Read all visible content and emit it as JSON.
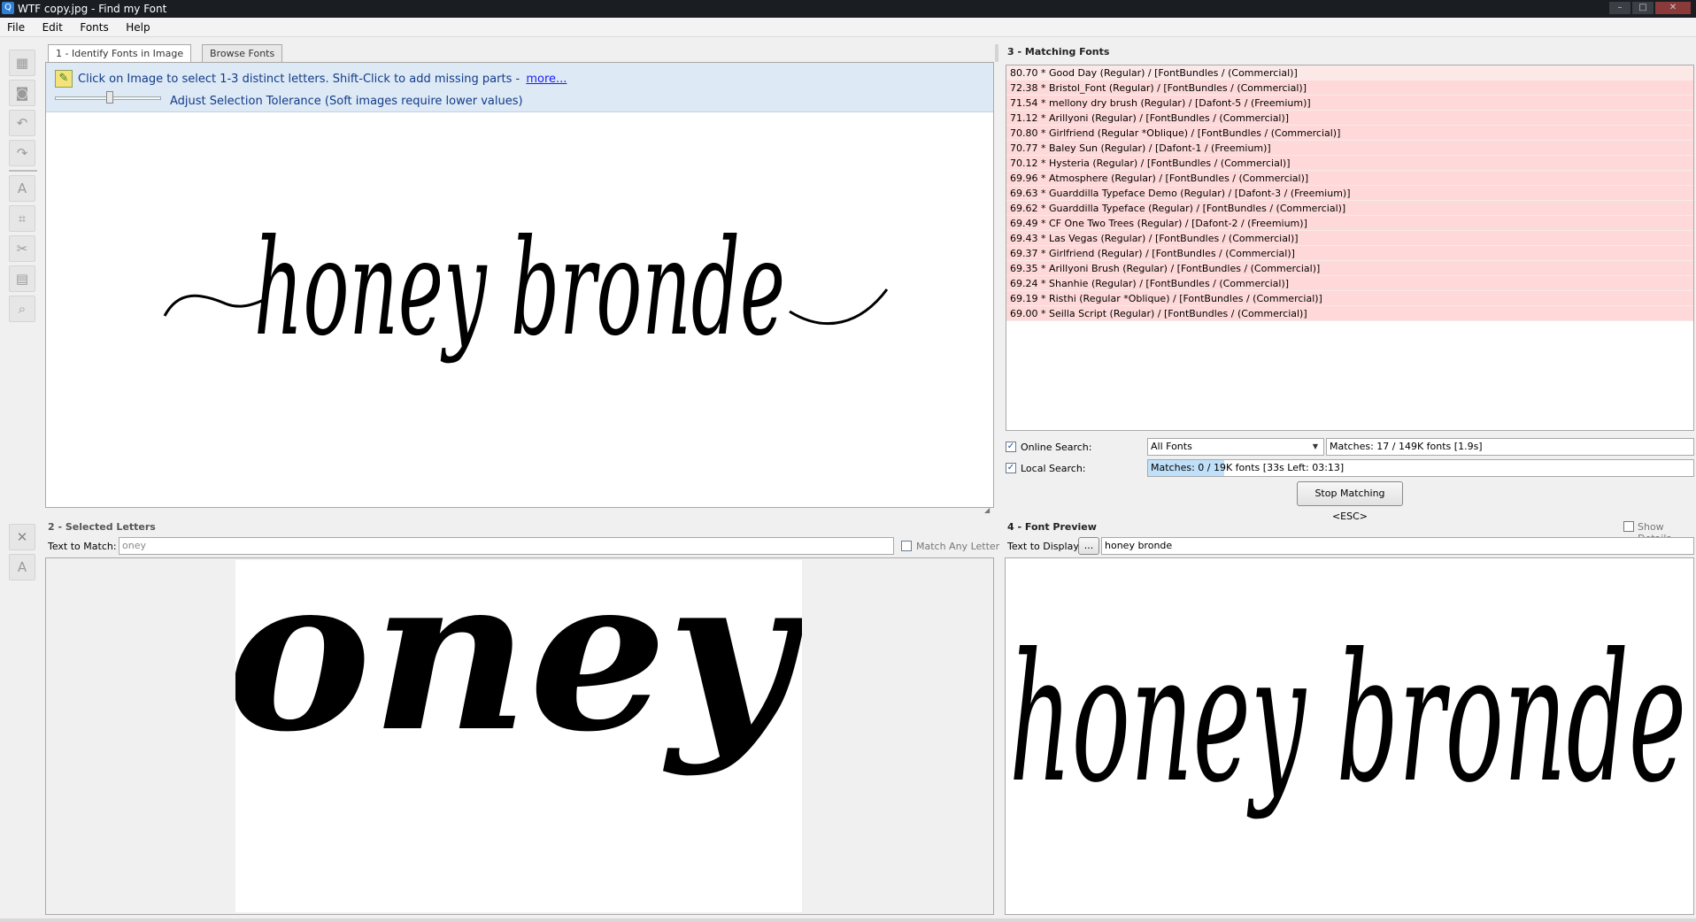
{
  "window": {
    "title": "WTF copy.jpg - Find my Font",
    "app_icon": "magnifier-icon",
    "controls": [
      "minimize",
      "maximize",
      "close"
    ]
  },
  "menu": [
    "File",
    "Edit",
    "Fonts",
    "Help"
  ],
  "toolbar_icons": [
    "identify-icon",
    "camera-icon",
    "undo-icon",
    "redo-icon",
    "add-letter-icon",
    "crop-icon",
    "cut-icon",
    "image-icon",
    "zoom-icon"
  ],
  "panel1": {
    "tabs": [
      "1 - Identify Fonts in Image",
      "Browse Fonts"
    ],
    "instruction": "Click on Image to select 1-3 distinct letters. Shift-Click to add missing parts -",
    "more_link": "more...",
    "tolerance_label": "Adjust Selection Tolerance (Soft images require lower values)",
    "tolerance_value": 0.5,
    "image_text": "honey bronde"
  },
  "panel2": {
    "title": "2 - Selected Letters",
    "text_to_match_label": "Text to Match:",
    "text_to_match_value": "oney",
    "match_any_letter_label": "Match Any Letter",
    "match_any_letter_checked": false,
    "letters_image_text": "oney"
  },
  "panel3": {
    "title": "3 - Matching Fonts",
    "matches": [
      "80.70 * Good Day (Regular) / [FontBundles / (Commercial)]",
      "72.38 * Bristol_Font (Regular) / [FontBundles / (Commercial)]",
      "71.54 * mellony dry brush (Regular) / [Dafont-5 / (Freemium)]",
      "71.12 * Arillyoni (Regular) / [FontBundles / (Commercial)]",
      "70.80 * Girlfriend (Regular *Oblique) / [FontBundles / (Commercial)]",
      "70.77 * Baley Sun (Regular) / [Dafont-1 / (Freemium)]",
      "70.12 * Hysteria (Regular) / [FontBundles / (Commercial)]",
      "69.96 * Atmosphere (Regular) / [FontBundles / (Commercial)]",
      "69.63 * Guarddilla Typeface Demo (Regular) / [Dafont-3 / (Freemium)]",
      "69.62 * Guarddilla Typeface (Regular) / [FontBundles / (Commercial)]",
      "69.49 * CF One Two Trees (Regular) / [Dafont-2 / (Freemium)]",
      "69.43 * Las Vegas (Regular) / [FontBundles / (Commercial)]",
      "69.37 * Girlfriend (Regular) / [FontBundles / (Commercial)]",
      "69.35 * Arillyoni Brush (Regular) / [FontBundles / (Commercial)]",
      "69.24 * Shanhie (Regular) / [FontBundles / (Commercial)]",
      "69.19 * Risthi (Regular *Oblique) / [FontBundles / (Commercial)]",
      "69.00 * Seilla Script (Regular) / [FontBundles / (Commercial)]"
    ],
    "online_search_label": "Online Search:",
    "online_search_checked": true,
    "online_source": "All Fonts",
    "online_status": "Matches: 17 / 149K fonts [1.9s]",
    "local_search_label": "Local Search:",
    "local_search_checked": true,
    "local_status": "Matches: 0 / 19K fonts [33s Left: 03:13]",
    "local_progress": 0.14,
    "stop_button": "Stop Matching  <ESC>"
  },
  "panel4": {
    "title": "4 - Font Preview",
    "show_details_label": "Show Details",
    "show_details_checked": false,
    "text_to_display_label": "Text to Display:",
    "ellipsis_button": "...",
    "text_to_display_value": "honey bronde",
    "preview_text": "honey bronde"
  },
  "colors": {
    "match_row": "#ffd9d9",
    "instruction_bg": "#dde9f4",
    "title_bar": "#1a1d22"
  }
}
